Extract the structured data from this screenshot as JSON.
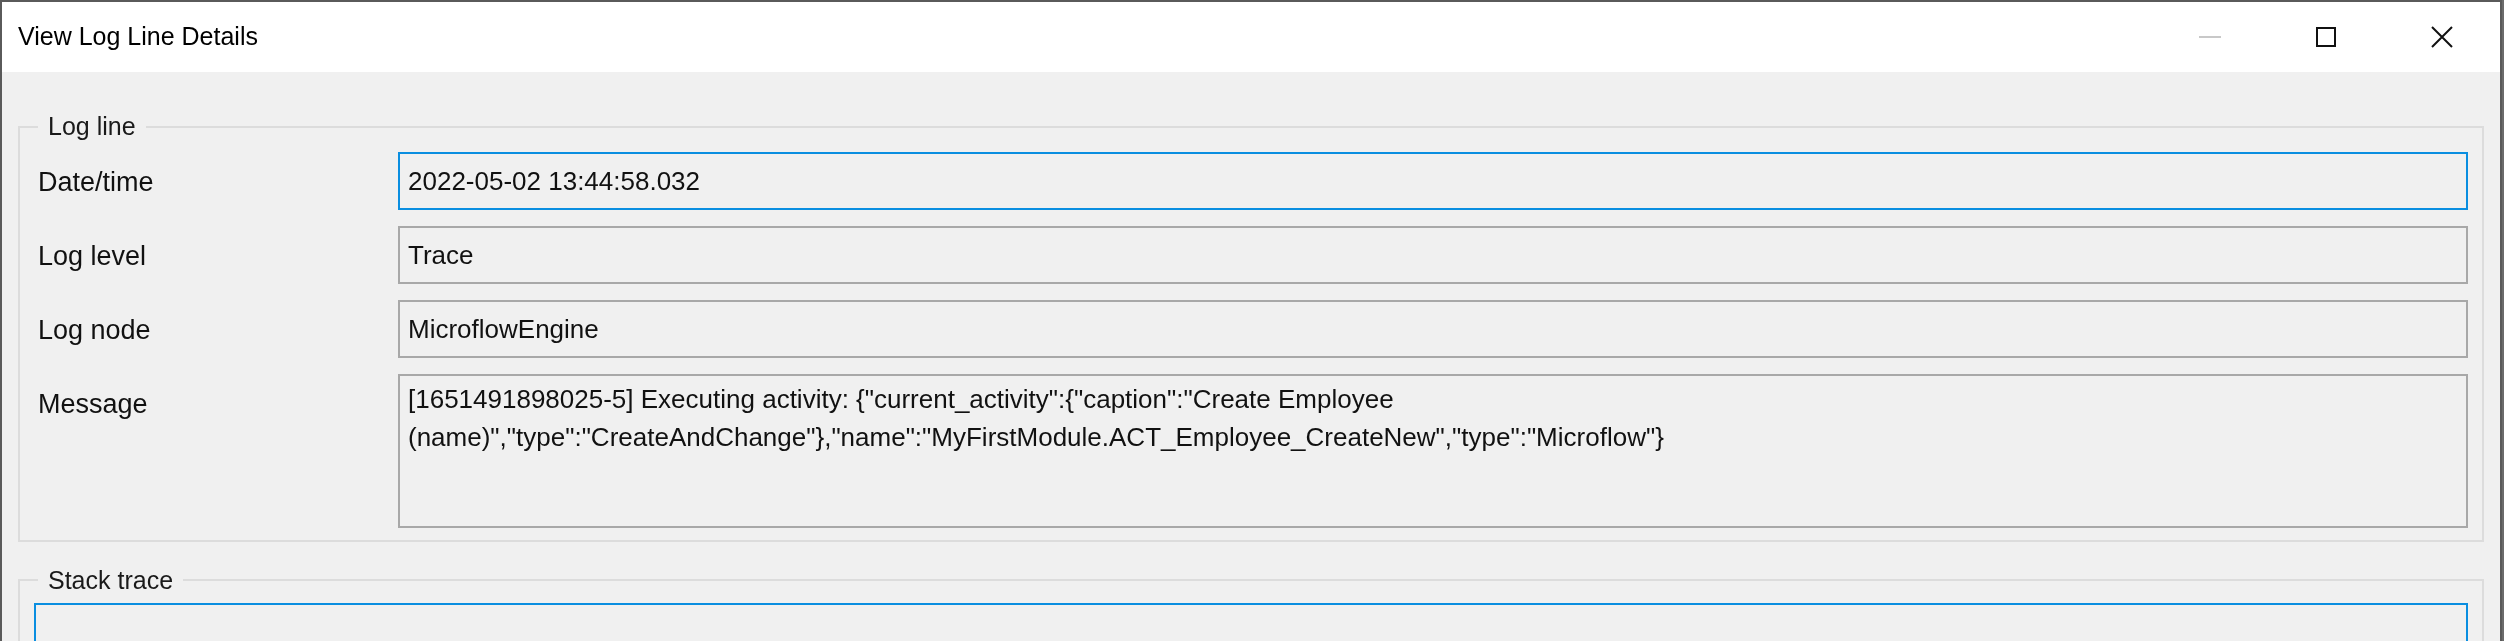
{
  "window": {
    "title": "View Log Line Details",
    "controls": [
      {
        "kind": "minimize",
        "disabled": true
      },
      {
        "kind": "maximize",
        "disabled": false
      },
      {
        "kind": "close",
        "disabled": false
      }
    ]
  },
  "log_line": {
    "legend": "Log line",
    "fields": [
      {
        "label": "Date/time",
        "value": "2022-05-02 13:44:58.032",
        "focused": true,
        "kind": "single"
      },
      {
        "label": "Log level",
        "value": "Trace",
        "focused": false,
        "kind": "single"
      },
      {
        "label": "Log node",
        "value": "MicroflowEngine",
        "focused": false,
        "kind": "single"
      },
      {
        "label": "Message",
        "value": "[1651491898025-5] Executing activity: {\"current_activity\":{\"caption\":\"Create Employee (name)\",\"type\":\"CreateAndChange\"},\"name\":\"MyFirstModule.ACT_Employee_CreateNew\",\"type\":\"Microflow\"}",
        "focused": false,
        "kind": "multi"
      }
    ]
  },
  "stack_trace": {
    "legend": "Stack trace",
    "focused": true
  }
}
